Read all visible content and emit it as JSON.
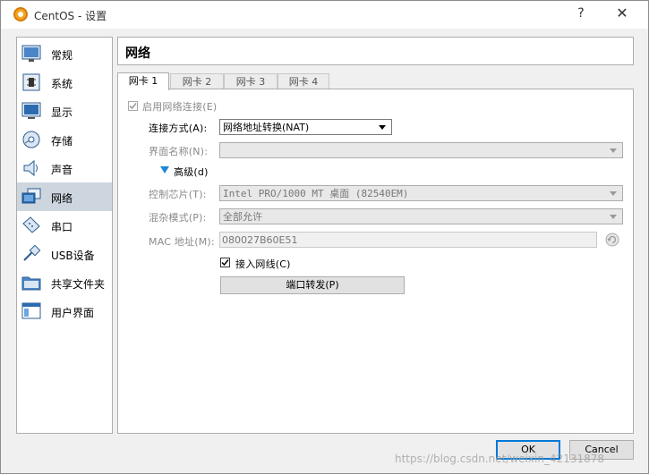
{
  "window": {
    "title": "CentOS - 设置",
    "help_label": "?",
    "close_label": "✕"
  },
  "sidebar": {
    "items": [
      {
        "label": "常规",
        "icon": "general-icon"
      },
      {
        "label": "系统",
        "icon": "system-icon"
      },
      {
        "label": "显示",
        "icon": "display-icon"
      },
      {
        "label": "存储",
        "icon": "storage-icon"
      },
      {
        "label": "声音",
        "icon": "audio-icon"
      },
      {
        "label": "网络",
        "icon": "network-icon",
        "active": true
      },
      {
        "label": "串口",
        "icon": "serial-port-icon"
      },
      {
        "label": "USB设备",
        "icon": "usb-icon"
      },
      {
        "label": "共享文件夹",
        "icon": "shared-folder-icon"
      },
      {
        "label": "用户界面",
        "icon": "user-interface-icon"
      }
    ]
  },
  "header": {
    "title": "网络"
  },
  "tabs": [
    {
      "label": "网卡 1",
      "active": true
    },
    {
      "label": "网卡 2"
    },
    {
      "label": "网卡 3"
    },
    {
      "label": "网卡 4"
    }
  ],
  "adapter": {
    "enable_label": "启用网络连接(E)",
    "enable_checked": true,
    "attached_label": "连接方式(A):",
    "attached_value": "网络地址转换(NAT)",
    "name_label": "界面名称(N):",
    "name_value": "",
    "advanced_label": "高级(d)",
    "chip_label": "控制芯片(T):",
    "chip_value": "Intel PRO/1000 MT 桌面 (82540EM)",
    "promisc_label": "混杂模式(P):",
    "promisc_value": "全部允许",
    "mac_label": "MAC 地址(M):",
    "mac_value": "080027B60E51",
    "cable_label": "接入网线(C)",
    "cable_checked": true,
    "port_forward_label": "端口转发(P)"
  },
  "footer": {
    "ok_label": "OK",
    "cancel_label": "Cancel"
  },
  "watermark": "https://blog.csdn.net/weixin_42131878"
}
